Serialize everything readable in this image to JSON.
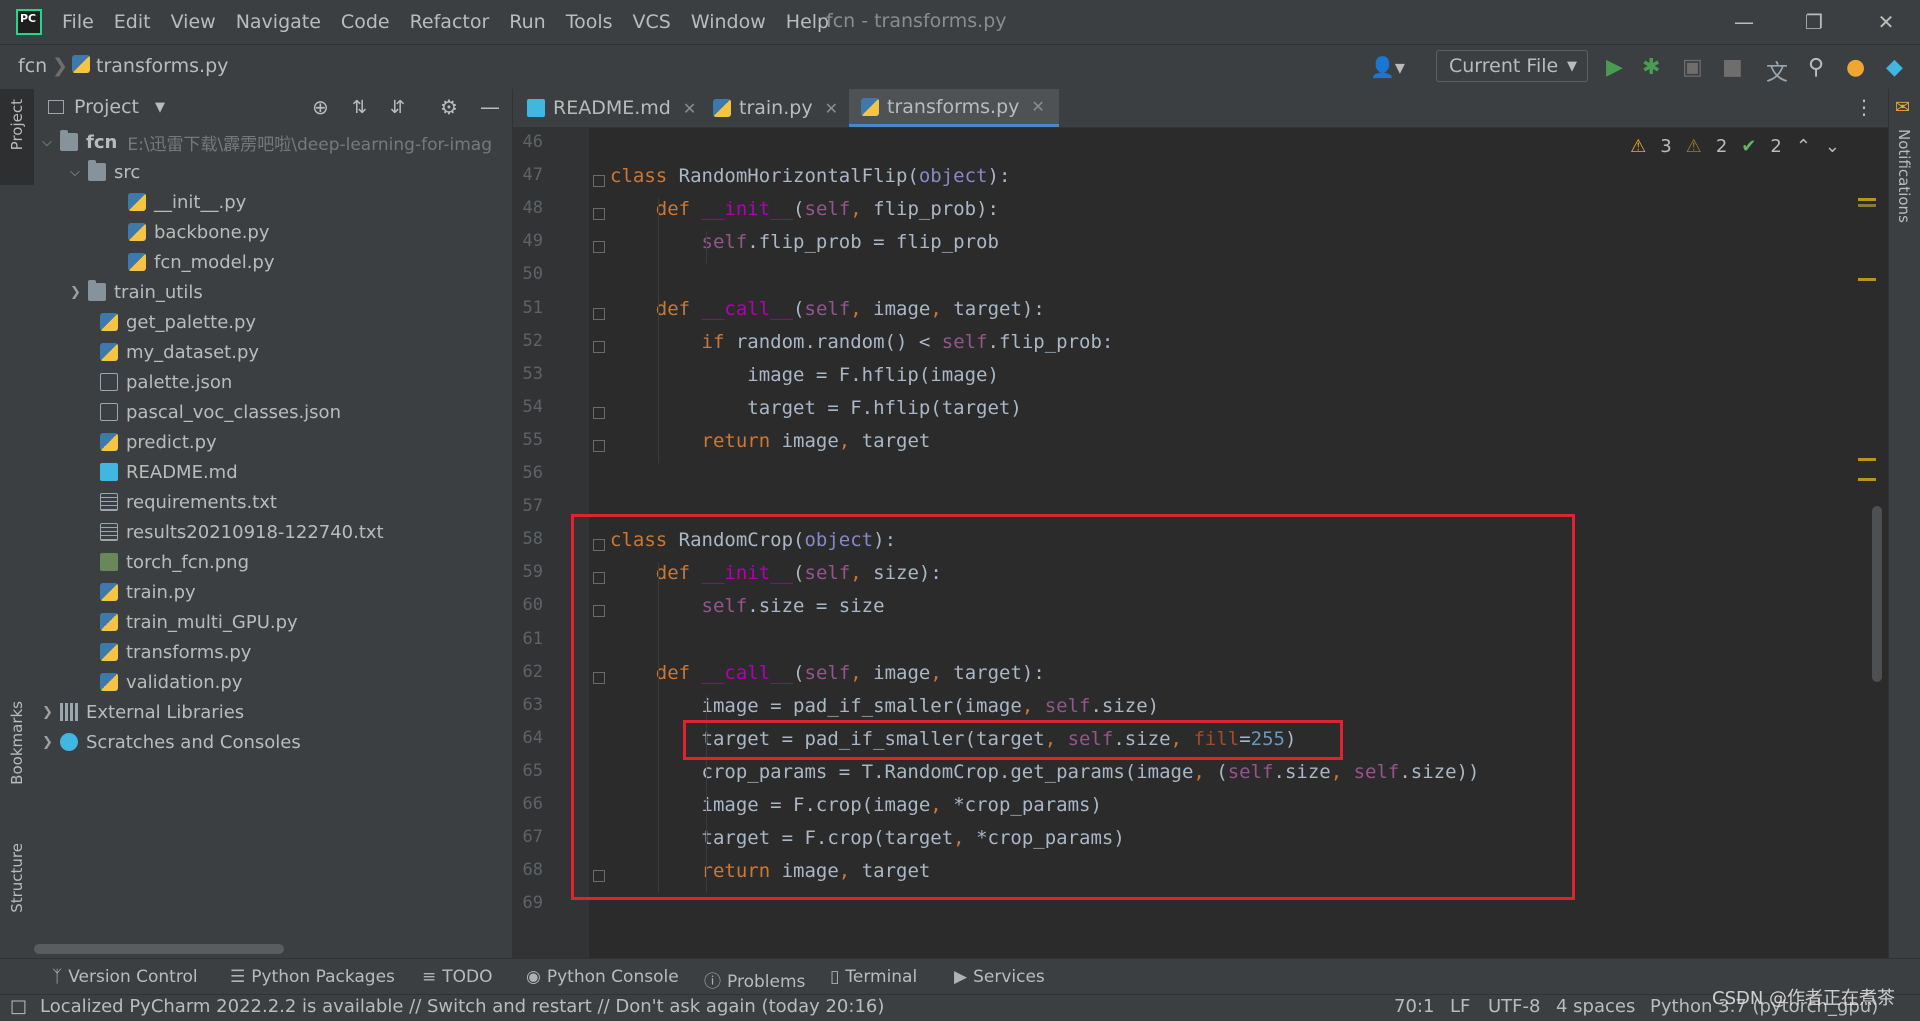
{
  "menu": [
    "File",
    "Edit",
    "View",
    "Navigate",
    "Code",
    "Refactor",
    "Run",
    "Tools",
    "VCS",
    "Window",
    "Help"
  ],
  "window_title": "fcn - transforms.py",
  "nav": {
    "project": "fcn",
    "file": "transforms.py",
    "run_config": "Current File"
  },
  "left_stripe": {
    "project": "Project",
    "bookmarks": "Bookmarks",
    "structure": "Structure"
  },
  "right_stripe": {
    "notifications": "Notifications"
  },
  "project_panel": {
    "title": "Project",
    "root": {
      "name": "fcn",
      "path": "E:\\迅雷下载\\霹雳吧啦\\deep-learning-for-imag"
    },
    "src": "src",
    "src_files": [
      "__init__.py",
      "backbone.py",
      "fcn_model.py"
    ],
    "train_utils": "train_utils",
    "files": [
      {
        "name": "get_palette.py",
        "icon": "py"
      },
      {
        "name": "my_dataset.py",
        "icon": "py"
      },
      {
        "name": "palette.json",
        "icon": "json"
      },
      {
        "name": "pascal_voc_classes.json",
        "icon": "json"
      },
      {
        "name": "predict.py",
        "icon": "py"
      },
      {
        "name": "README.md",
        "icon": "md"
      },
      {
        "name": "requirements.txt",
        "icon": "txt"
      },
      {
        "name": "results20210918-122740.txt",
        "icon": "txt"
      },
      {
        "name": "torch_fcn.png",
        "icon": "png"
      },
      {
        "name": "train.py",
        "icon": "py"
      },
      {
        "name": "train_multi_GPU.py",
        "icon": "py"
      },
      {
        "name": "transforms.py",
        "icon": "py"
      },
      {
        "name": "validation.py",
        "icon": "py"
      }
    ],
    "external_libraries": "External Libraries",
    "scratches": "Scratches and Consoles"
  },
  "tabs": [
    {
      "label": "README.md",
      "active": false
    },
    {
      "label": "train.py",
      "active": false
    },
    {
      "label": "transforms.py",
      "active": true
    }
  ],
  "inspections": {
    "warnings_a": "3",
    "warnings_b": "2",
    "ok": "2"
  },
  "line_numbers": [
    "46",
    "47",
    "48",
    "49",
    "50",
    "51",
    "52",
    "53",
    "54",
    "55",
    "56",
    "57",
    "58",
    "59",
    "60",
    "61",
    "62",
    "63",
    "64",
    "65",
    "66",
    "67",
    "68",
    "69"
  ],
  "code": [
    [],
    [
      [
        "kw",
        "class "
      ],
      [
        "n",
        "RandomHorizontalFlip("
      ],
      [
        "builtin",
        "object"
      ],
      [
        "n",
        "):"
      ]
    ],
    [
      [
        "n",
        "    "
      ],
      [
        "kw",
        "def "
      ],
      [
        "dund",
        "__init__"
      ],
      [
        "n",
        "("
      ],
      [
        "self",
        "self"
      ],
      [
        "kw",
        ", "
      ],
      [
        "n",
        "flip_prob):"
      ]
    ],
    [
      [
        "n",
        "        "
      ],
      [
        "self",
        "self"
      ],
      [
        "n",
        ".flip_prob = flip_prob"
      ]
    ],
    [],
    [
      [
        "n",
        "    "
      ],
      [
        "kw",
        "def "
      ],
      [
        "dund",
        "__call__"
      ],
      [
        "n",
        "("
      ],
      [
        "self",
        "self"
      ],
      [
        "kw",
        ", "
      ],
      [
        "n",
        "image"
      ],
      [
        "kw",
        ", "
      ],
      [
        "n",
        "target):"
      ]
    ],
    [
      [
        "n",
        "        "
      ],
      [
        "kw",
        "if "
      ],
      [
        "n",
        "random.random() < "
      ],
      [
        "self",
        "self"
      ],
      [
        "n",
        ".flip_prob:"
      ]
    ],
    [
      [
        "n",
        "            image = F.hflip(image)"
      ]
    ],
    [
      [
        "n",
        "            target = F.hflip(target)"
      ]
    ],
    [
      [
        "n",
        "        "
      ],
      [
        "kw",
        "return "
      ],
      [
        "n",
        "image"
      ],
      [
        "kw",
        ", "
      ],
      [
        "n",
        "target"
      ]
    ],
    [],
    [],
    [
      [
        "kw",
        "class "
      ],
      [
        "n",
        "RandomCrop("
      ],
      [
        "builtin",
        "object"
      ],
      [
        "n",
        "):"
      ]
    ],
    [
      [
        "n",
        "    "
      ],
      [
        "kw",
        "def "
      ],
      [
        "dund",
        "__init__"
      ],
      [
        "n",
        "("
      ],
      [
        "self",
        "self"
      ],
      [
        "kw",
        ", "
      ],
      [
        "n",
        "size):"
      ]
    ],
    [
      [
        "n",
        "        "
      ],
      [
        "self",
        "self"
      ],
      [
        "n",
        ".size = size"
      ]
    ],
    [],
    [
      [
        "n",
        "    "
      ],
      [
        "kw",
        "def "
      ],
      [
        "dund",
        "__call__"
      ],
      [
        "n",
        "("
      ],
      [
        "self",
        "self"
      ],
      [
        "kw",
        ", "
      ],
      [
        "n",
        "image"
      ],
      [
        "kw",
        ", "
      ],
      [
        "n",
        "target):"
      ]
    ],
    [
      [
        "n",
        "        image = pad_if_smaller(image"
      ],
      [
        "kw",
        ", "
      ],
      [
        "self",
        "self"
      ],
      [
        "n",
        ".size)"
      ]
    ],
    [
      [
        "n",
        "        target = pad_if_smaller(target"
      ],
      [
        "kw",
        ", "
      ],
      [
        "self",
        "self"
      ],
      [
        "n",
        ".size"
      ],
      [
        "kw",
        ", "
      ],
      [
        "param",
        "fill"
      ],
      [
        "n",
        "="
      ],
      [
        "num",
        "255"
      ],
      [
        "n",
        ")"
      ]
    ],
    [
      [
        "n",
        "        crop_params = T.RandomCrop.get_params(image"
      ],
      [
        "kw",
        ", "
      ],
      [
        "n",
        "("
      ],
      [
        "self",
        "self"
      ],
      [
        "n",
        ".size"
      ],
      [
        "kw",
        ", "
      ],
      [
        "self",
        "self"
      ],
      [
        "n",
        ".size))"
      ]
    ],
    [
      [
        "n",
        "        image = F.crop(image"
      ],
      [
        "kw",
        ", "
      ],
      [
        "n",
        "*crop_params)"
      ]
    ],
    [
      [
        "n",
        "        target = F.crop(target"
      ],
      [
        "kw",
        ", "
      ],
      [
        "n",
        "*crop_params)"
      ]
    ],
    [
      [
        "n",
        "        "
      ],
      [
        "kw",
        "return "
      ],
      [
        "n",
        "image"
      ],
      [
        "kw",
        ", "
      ],
      [
        "n",
        "target"
      ]
    ],
    []
  ],
  "tool_windows": [
    "Version Control",
    "Python Packages",
    "TODO",
    "Python Console",
    "Problems",
    "Terminal",
    "Services"
  ],
  "status": {
    "message": "Localized PyCharm 2022.2.2 is available // Switch and restart // Don't ask again (today 20:16)",
    "position": "70:1",
    "line_sep": "LF",
    "encoding": "UTF-8",
    "indent": "4 spaces",
    "interpreter": "Python 3.7 (pytorch_gpu)"
  },
  "watermark": "CSDN @作者正在煮茶",
  "colors": {
    "accent": "#4A88C7",
    "highlight_box": "#E0242E",
    "keyword": "#CC7832",
    "self": "#94558D"
  }
}
